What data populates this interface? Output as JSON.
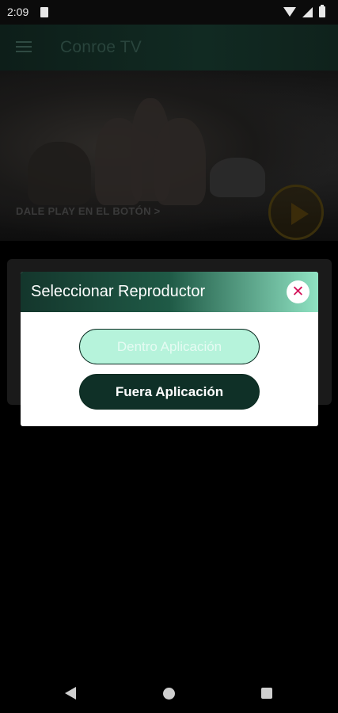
{
  "status_bar": {
    "time": "2:09",
    "icons": [
      "sim-card-icon",
      "wifi-icon",
      "signal-icon",
      "battery-icon"
    ]
  },
  "app_bar": {
    "title": "Conroe TV",
    "menu_icon": "hamburger-menu-icon"
  },
  "hero": {
    "caption": "DALE PLAY EN EL BOTÓN >",
    "play_icon": "play-circle-icon"
  },
  "dialog": {
    "title": "Seleccionar Reproductor",
    "close_icon": "close-icon",
    "close_symbol": "✕",
    "options": [
      {
        "label": "Dentro Aplicación"
      },
      {
        "label": "Fuera Aplicación"
      }
    ]
  },
  "nav_bar": {
    "icons": [
      "back-icon",
      "home-icon",
      "recents-icon"
    ]
  },
  "colors": {
    "header_dark": "#14362c",
    "header_light": "#8fe2c2",
    "button_light": "#b6f3db",
    "button_dark": "#0f3027",
    "close_accent": "#d4145a"
  }
}
